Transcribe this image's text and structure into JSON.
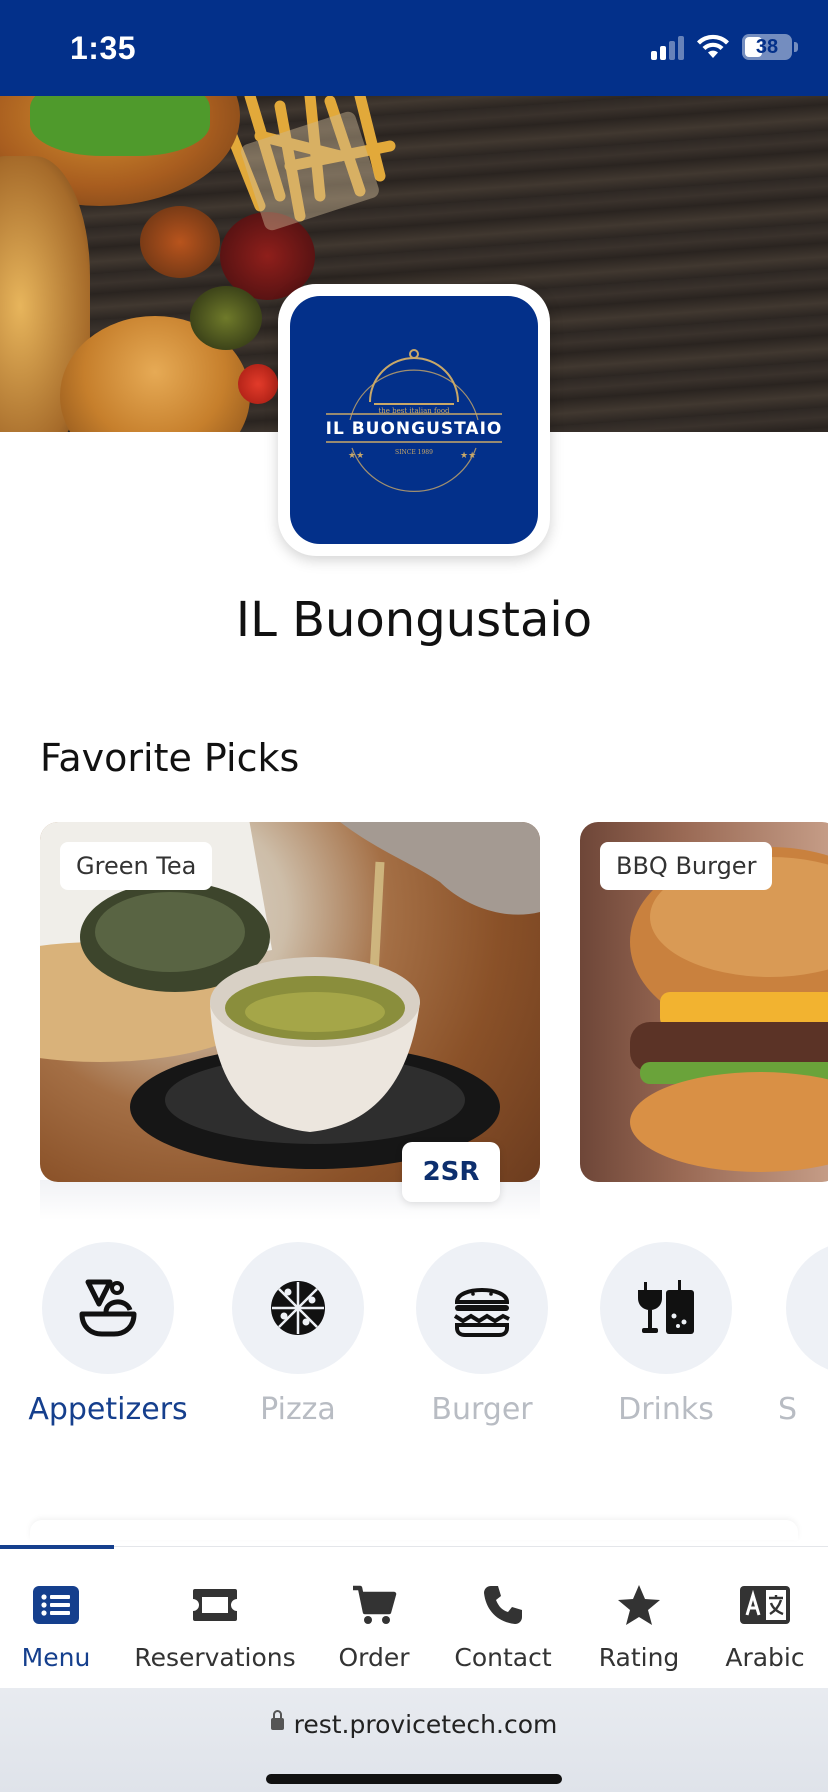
{
  "status_bar": {
    "time": "1:35",
    "battery": "38"
  },
  "restaurant": {
    "name": "IL Buongustaio",
    "logo": {
      "tagline": "the best italian food",
      "title": "IL BUONGUSTAIO",
      "since": "SINCE 1989"
    }
  },
  "favorites": {
    "title": "Favorite Picks",
    "items": [
      {
        "label": "Green Tea",
        "price": "2SR"
      },
      {
        "label": "BBQ Burger"
      }
    ]
  },
  "categories": [
    {
      "label": "Appetizers",
      "icon": "appetizers-icon",
      "active": true
    },
    {
      "label": "Pizza",
      "icon": "pizza-icon"
    },
    {
      "label": "Burger",
      "icon": "burger-icon"
    },
    {
      "label": "Drinks",
      "icon": "drinks-icon"
    },
    {
      "label": "S",
      "icon": "more-icon"
    }
  ],
  "bottom_nav": [
    {
      "label": "Menu",
      "icon": "list-icon",
      "active": true
    },
    {
      "label": "Reservations",
      "icon": "ticket-icon"
    },
    {
      "label": "Order",
      "icon": "cart-icon"
    },
    {
      "label": "Contact",
      "icon": "phone-icon"
    },
    {
      "label": "Rating",
      "icon": "star-icon"
    },
    {
      "label": "Arabic",
      "icon": "translate-icon"
    }
  ],
  "browser": {
    "url": "rest.provicetech.com"
  },
  "colors": {
    "brand": "#03308a",
    "accent": "#153f8d",
    "inactive": "#b8bcc3",
    "category_bg": "#eef1f6"
  }
}
